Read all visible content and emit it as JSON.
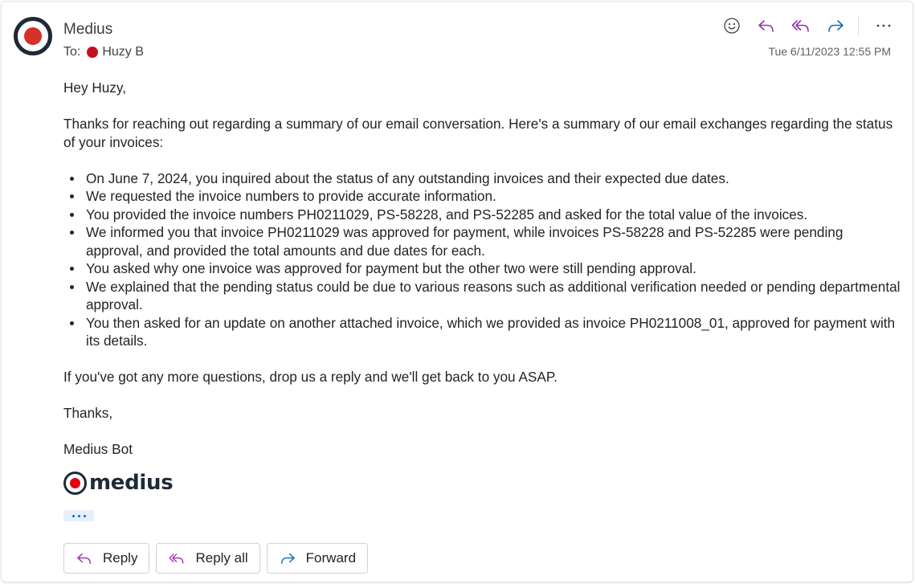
{
  "header": {
    "sender": "Medius",
    "to_label": "To:",
    "recipient": "Huzy B",
    "timestamp": "Tue 6/11/2023 12:55 PM",
    "icons": [
      "emoji-icon",
      "reply-icon",
      "reply-all-icon",
      "forward-icon",
      "more-options-icon"
    ]
  },
  "colors": {
    "reply_accent": "#9b2fae",
    "forward_accent": "#0f6cbd",
    "brand_red": "#e3000f",
    "brand_dark": "#1f2a37"
  },
  "message": {
    "greeting": "Hey Huzy,",
    "intro": "Thanks for reaching out regarding a summary of our email conversation. Here's a summary of our email exchanges regarding the status of your invoices:",
    "bullets": [
      "On June 7, 2024, you inquired about the status of any outstanding invoices and their expected due dates.",
      "We requested the invoice numbers to provide accurate information.",
      "You provided the invoice numbers PH0211029, PS-58228, and PS-52285 and asked for the total value of the invoices.",
      "We informed you that invoice PH0211029 was approved for payment, while invoices PS-58228 and PS-52285 were pending approval, and provided the total amounts and due dates for each.",
      "You asked why one invoice was approved for payment but the other two were still pending approval.",
      "We explained that the pending status could be due to various reasons such as additional verification needed or pending departmental approval.",
      "You then asked for an update on another attached invoice, which we provided as invoice PH0211008_01, approved for payment with its details."
    ],
    "closing": "If you've got any more questions, drop us a reply and we'll get back to you ASAP.",
    "signoff": "Thanks,",
    "signature": "Medius Bot",
    "logo_text": "medius"
  },
  "footer": {
    "reply_label": "Reply",
    "reply_all_label": "Reply all",
    "forward_label": "Forward"
  }
}
